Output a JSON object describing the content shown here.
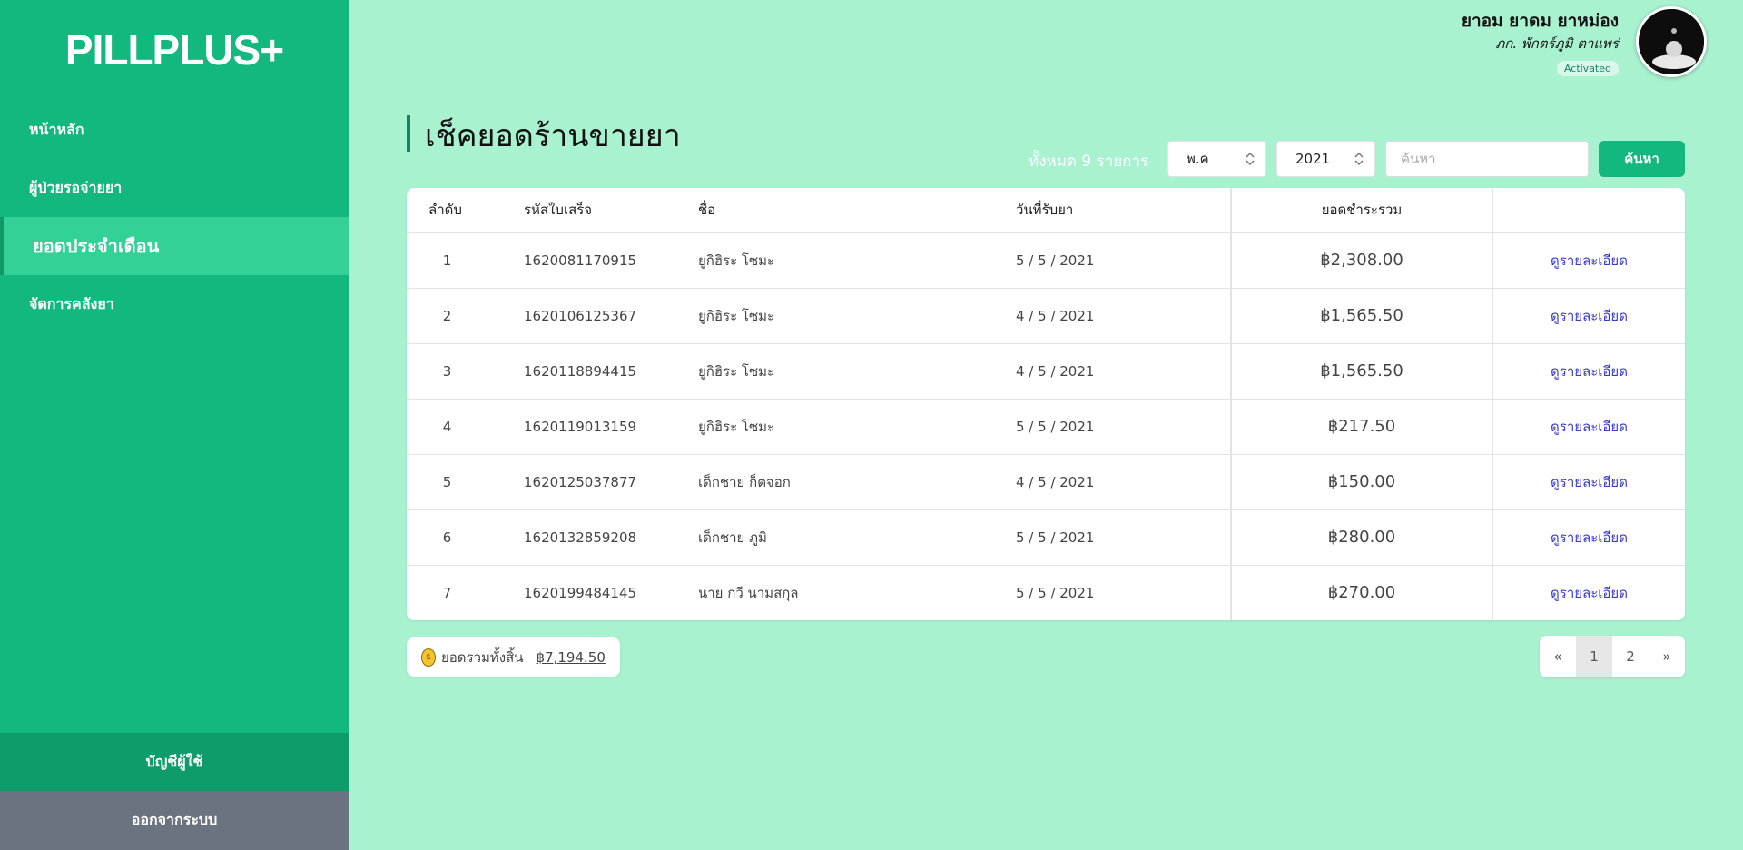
{
  "sidebar": {
    "logo": "PILLPLUS+",
    "items": [
      {
        "label": "หน้าหลัก"
      },
      {
        "label": "ผู้ป่วยรอจ่ายยา"
      },
      {
        "label": "ยอดประจำเดือน"
      },
      {
        "label": "จัดการคลังยา"
      }
    ],
    "account_label": "บัญชีผู้ใช้",
    "logout_label": "ออกจากระบบ"
  },
  "profile": {
    "name": "ยาอม ยาดม ยาหม่อง",
    "subtitle": "ภก. พักตร์ภูมิ ตาแพร่",
    "badge": "Activated"
  },
  "page": {
    "title": "เช็คยอดร้านขายยา",
    "total_count": "ทั้งหมด 9 รายการ",
    "month_select": "พ.ค",
    "year_select": "2021",
    "search_placeholder": "ค้นหา",
    "search_button": "ค้นหา"
  },
  "table": {
    "headers": [
      "ลำดับ",
      "รหัสใบเสร็จ",
      "ชื่อ",
      "วันที่รับยา",
      "ยอดชำระรวม",
      ""
    ],
    "rows": [
      {
        "idx": "1",
        "code": "1620081170915",
        "name": "ยูกิฮิระ โซมะ",
        "date": "5 / 5 / 2021",
        "amount": "฿2,308.00",
        "link": "ดูรายละเอียด"
      },
      {
        "idx": "2",
        "code": "1620106125367",
        "name": "ยูกิฮิระ โซมะ",
        "date": "4 / 5 / 2021",
        "amount": "฿1,565.50",
        "link": "ดูรายละเอียด"
      },
      {
        "idx": "3",
        "code": "1620118894415",
        "name": "ยูกิฮิระ โซมะ",
        "date": "4 / 5 / 2021",
        "amount": "฿1,565.50",
        "link": "ดูรายละเอียด"
      },
      {
        "idx": "4",
        "code": "1620119013159",
        "name": "ยูกิฮิระ โซมะ",
        "date": "5 / 5 / 2021",
        "amount": "฿217.50",
        "link": "ดูรายละเอียด"
      },
      {
        "idx": "5",
        "code": "1620125037877",
        "name": "เด็กชาย ก็ตจอก",
        "date": "4 / 5 / 2021",
        "amount": "฿150.00",
        "link": "ดูรายละเอียด"
      },
      {
        "idx": "6",
        "code": "1620132859208",
        "name": "เด็กชาย ภูมิ",
        "date": "5 / 5 / 2021",
        "amount": "฿280.00",
        "link": "ดูรายละเอียด"
      },
      {
        "idx": "7",
        "code": "1620199484145",
        "name": "นาย กวี นามสกุล",
        "date": "5 / 5 / 2021",
        "amount": "฿270.00",
        "link": "ดูรายละเอียด"
      }
    ]
  },
  "summary": {
    "icon": "coin-bag-icon",
    "label": "ยอดรวมทั้งสิ้น",
    "total": "฿7,194.50"
  },
  "pagination": {
    "prev": "«",
    "pages": [
      "1",
      "2"
    ],
    "current": "1",
    "next": "»"
  },
  "colors": {
    "sidebar": "#13b87e",
    "active_item": "#33d196",
    "background": "#a8f2d0",
    "link": "#3b3bd1"
  }
}
